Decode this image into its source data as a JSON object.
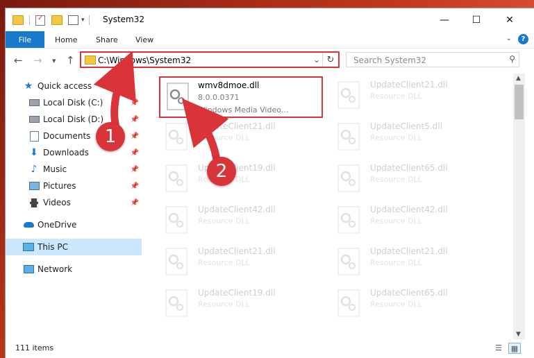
{
  "window": {
    "title": "System32"
  },
  "window_controls": {
    "minimize": "—",
    "maximize": "☐",
    "close": "✕"
  },
  "ribbon": {
    "file": "File",
    "tabs": [
      "Home",
      "Share",
      "View"
    ],
    "help": "?"
  },
  "nav": {
    "back": "←",
    "forward": "→",
    "recent": "▾",
    "up": "↑"
  },
  "address": {
    "path": "C:\\Windows\\System32",
    "dropdown": "⌄",
    "refresh": "↻"
  },
  "search": {
    "placeholder": "Search System32"
  },
  "sidebar": {
    "items": [
      {
        "label": "Quick access",
        "icon": "star-icon",
        "pinned": false
      },
      {
        "label": "Local Disk (C:)",
        "icon": "drive-icon",
        "pinned": true
      },
      {
        "label": "Local Disk (D:)",
        "icon": "drive-icon",
        "pinned": true
      },
      {
        "label": "Documents",
        "icon": "documents-icon",
        "pinned": true
      },
      {
        "label": "Downloads",
        "icon": "downloads-icon",
        "pinned": true
      },
      {
        "label": "Music",
        "icon": "music-icon",
        "pinned": true
      },
      {
        "label": "Pictures",
        "icon": "pictures-icon",
        "pinned": true
      },
      {
        "label": "Videos",
        "icon": "videos-icon",
        "pinned": true
      },
      {
        "label": "OneDrive",
        "icon": "onedrive-icon",
        "pinned": false
      },
      {
        "label": "This PC",
        "icon": "pc-icon",
        "pinned": false,
        "selected": true
      },
      {
        "label": "Network",
        "icon": "network-icon",
        "pinned": false
      }
    ]
  },
  "files": {
    "highlighted": {
      "name": "wmv8dmoe.dll",
      "version": "8.0.0.0371",
      "description": "Windows Media Video..."
    },
    "left_column": [
      {
        "name": "UpdateClient21.dll",
        "description": "Resource DLL"
      },
      {
        "name": "UpdateClient19.dll",
        "description": "Resource DLL"
      },
      {
        "name": "UpdateClient42.dll",
        "description": "Resource DLL"
      },
      {
        "name": "UpdateClient21.dll",
        "description": "Resource DLL"
      },
      {
        "name": "UpdateClient19.dll",
        "description": "Resource DLL"
      }
    ],
    "right_column": [
      {
        "name": "UpdateClient21.dll",
        "description": "Resource DLL"
      },
      {
        "name": "UpdateClient5.dll",
        "description": "Resource DLL"
      },
      {
        "name": "UpdateClient65.dll",
        "description": "Resource DLL"
      },
      {
        "name": "UpdateClient42.dll",
        "description": "Resource DLL"
      },
      {
        "name": "UpdateClient21.dll",
        "description": "Resource DLL"
      },
      {
        "name": "UpdateClient65.dll",
        "description": "Resource DLL"
      }
    ]
  },
  "status": {
    "item_count": "111 items"
  },
  "annotations": {
    "step1": "1",
    "step2": "2"
  },
  "colors": {
    "accent": "#1979ca",
    "highlight": "#d9343a",
    "selected": "#cce8ff"
  }
}
